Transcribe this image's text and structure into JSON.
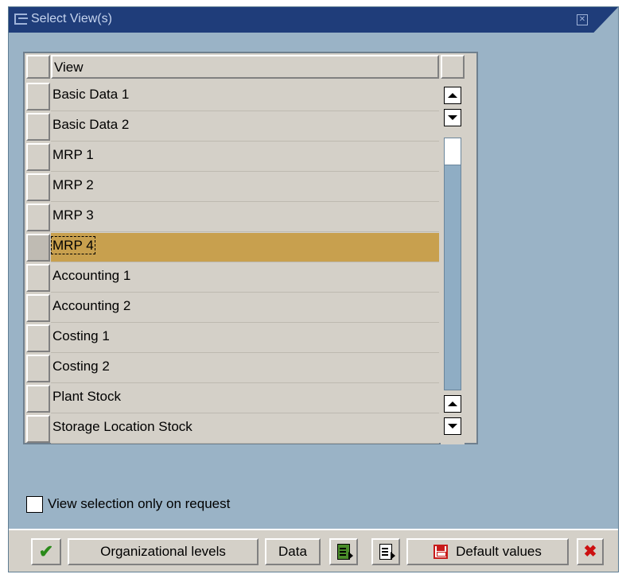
{
  "dialog": {
    "title": "Select View(s)",
    "table": {
      "column_header": "View",
      "rows": [
        {
          "label": "Basic Data 1",
          "selected": false
        },
        {
          "label": "Basic Data 2",
          "selected": false
        },
        {
          "label": "MRP 1",
          "selected": false
        },
        {
          "label": "MRP 2",
          "selected": false
        },
        {
          "label": "MRP 3",
          "selected": false
        },
        {
          "label": "MRP 4",
          "selected": true
        },
        {
          "label": "Accounting 1",
          "selected": false
        },
        {
          "label": "Accounting 2",
          "selected": false
        },
        {
          "label": "Costing 1",
          "selected": false
        },
        {
          "label": "Costing 2",
          "selected": false
        },
        {
          "label": "Plant Stock",
          "selected": false
        },
        {
          "label": "Storage Location Stock",
          "selected": false
        }
      ]
    },
    "option": {
      "label": "View selection only on request",
      "checked": false
    },
    "toolbar": {
      "org_levels_label": "Organizational levels",
      "data_label": "Data",
      "default_values_label": "Default values"
    }
  },
  "colors": {
    "title_bar": "#1f3d7a",
    "dialog_bg": "#9ab3c6",
    "selected_row": "#c8a04e",
    "confirm_icon": "#2a8a1a",
    "cancel_icon": "#cc1010"
  },
  "icons": {
    "title": "dialog-window-icon",
    "close": "close-icon",
    "confirm": "checkmark-icon",
    "select_all": "select-all-icon",
    "deselect_all": "deselect-all-icon",
    "save": "save-icon",
    "cancel": "cancel-icon"
  }
}
